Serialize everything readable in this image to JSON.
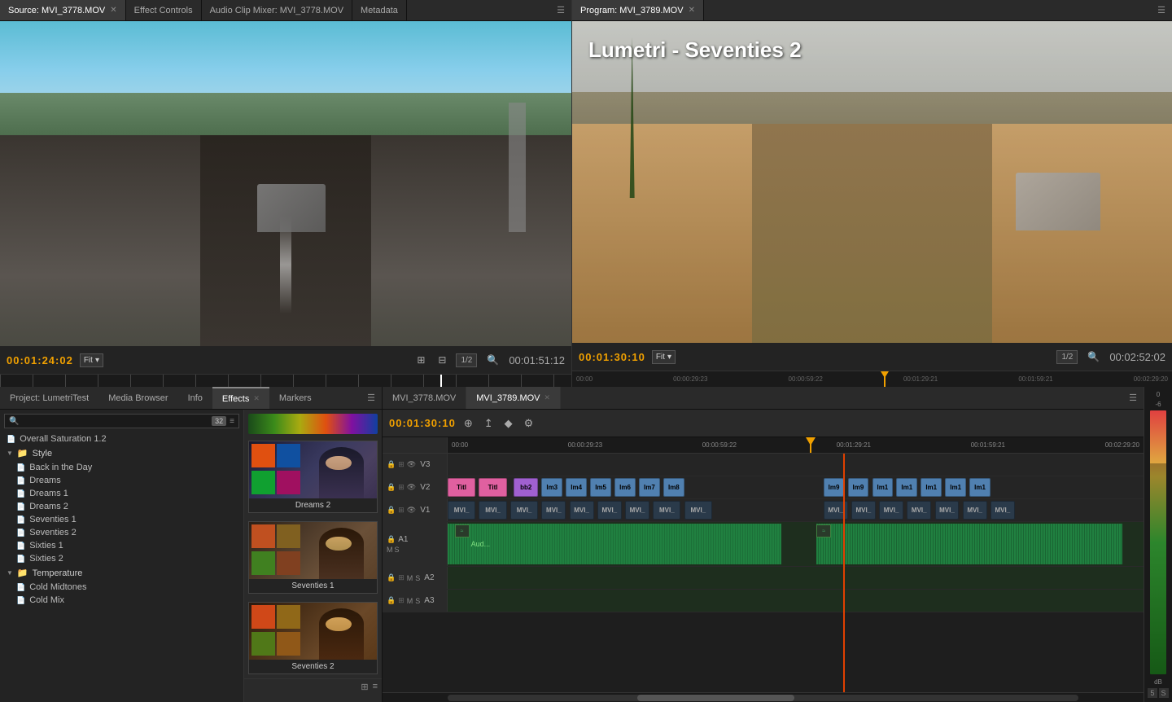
{
  "source_monitor": {
    "tabs": [
      {
        "label": "Source: MVI_3778.MOV",
        "active": true,
        "closeable": true
      },
      {
        "label": "Effect Controls",
        "active": false,
        "closeable": false
      },
      {
        "label": "Audio Clip Mixer: MVI_3778.MOV",
        "active": false,
        "closeable": false
      },
      {
        "label": "Metadata",
        "active": false,
        "closeable": false
      }
    ],
    "timecode": "00:01:24:02",
    "fit_label": "Fit",
    "fraction": "1/2",
    "duration": "00:01:51:12"
  },
  "program_monitor": {
    "title": "Program: MVI_3789.MOV",
    "video_label": "Lumetri - Seventies 2",
    "timecode": "00:01:30:10",
    "fit_label": "Fit",
    "fraction": "1/2",
    "duration": "00:02:52:02",
    "ruler_marks": [
      "00:00",
      "00:00:29:23",
      "00:00:59:22",
      "00:01:29:21",
      "00:01:59:21",
      "00:02:29:20"
    ]
  },
  "effects_panel": {
    "tabs": [
      {
        "label": "Project: LumetriTest",
        "active": false
      },
      {
        "label": "Media Browser",
        "active": false
      },
      {
        "label": "Info",
        "active": false
      },
      {
        "label": "Effects",
        "active": true,
        "closeable": true
      },
      {
        "label": "Markers",
        "active": false
      }
    ],
    "search_placeholder": "",
    "preset_selected": "Overall Saturation 1.2",
    "tree": [
      {
        "type": "preset",
        "label": "Overall Saturation 1.2",
        "indent": 0
      },
      {
        "type": "folder",
        "label": "Style",
        "expanded": true,
        "indent": 0
      },
      {
        "type": "preset",
        "label": "Back in the Day",
        "indent": 1
      },
      {
        "type": "preset",
        "label": "Dreams",
        "indent": 1
      },
      {
        "type": "preset",
        "label": "Dreams 1",
        "indent": 1
      },
      {
        "type": "preset",
        "label": "Dreams 2",
        "indent": 1
      },
      {
        "type": "preset",
        "label": "Seventies 1",
        "indent": 1
      },
      {
        "type": "preset",
        "label": "Seventies 2",
        "indent": 1
      },
      {
        "type": "preset",
        "label": "Sixties 1",
        "indent": 1
      },
      {
        "type": "preset",
        "label": "Sixties 2",
        "indent": 1
      },
      {
        "type": "folder",
        "label": "Temperature",
        "expanded": true,
        "indent": 0
      },
      {
        "type": "preset",
        "label": "Cold Midtones",
        "indent": 1
      },
      {
        "type": "preset",
        "label": "Cold Mix",
        "indent": 1
      }
    ],
    "presets_shown": [
      {
        "label": "Dreams 2"
      },
      {
        "label": "Seventies 1"
      },
      {
        "label": "Seventies 2"
      }
    ],
    "color_strip": true
  },
  "timeline": {
    "tabs": [
      {
        "label": "MVI_3778.MOV",
        "active": false
      },
      {
        "label": "MVI_3789.MOV",
        "active": true,
        "closeable": true
      }
    ],
    "timecode": "00:01:30:10",
    "ruler_marks": [
      "00:00",
      "00:00:29:23",
      "00:00:59:22",
      "00:01:29:21",
      "00:01:59:21",
      "00:02:29:20"
    ],
    "tracks": [
      {
        "id": "V3",
        "label": "V3",
        "type": "video"
      },
      {
        "id": "V2",
        "label": "V2",
        "type": "video"
      },
      {
        "id": "V1",
        "label": "V1",
        "type": "video"
      },
      {
        "id": "A1",
        "label": "A1",
        "type": "audio"
      },
      {
        "id": "A2",
        "label": "A2",
        "type": "audio"
      },
      {
        "id": "A3",
        "label": "A3",
        "type": "audio"
      }
    ]
  }
}
